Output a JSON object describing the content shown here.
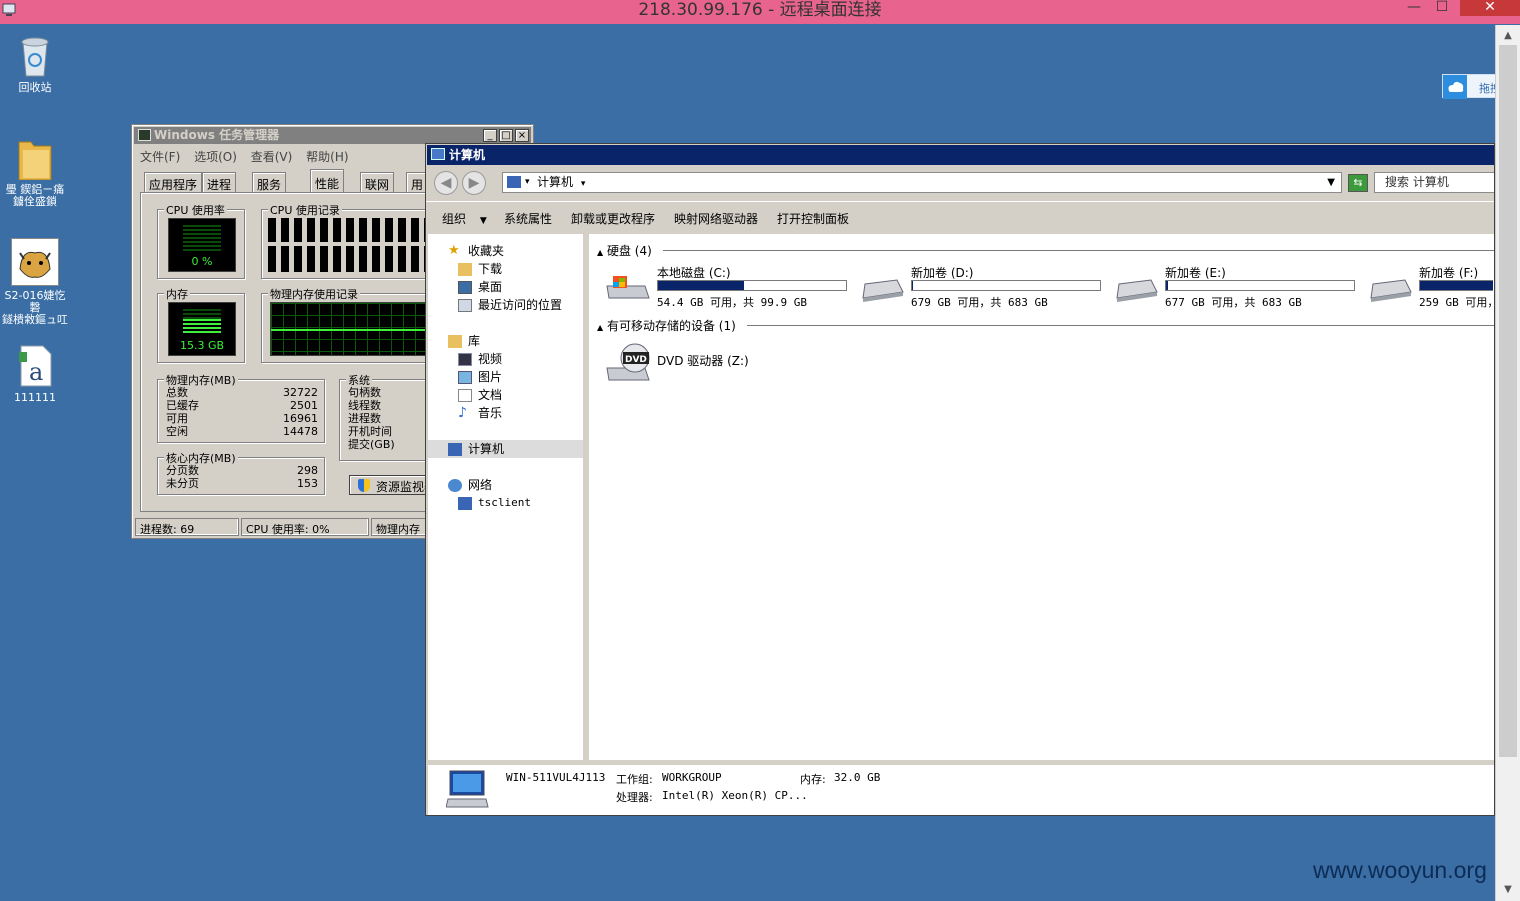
{
  "rdp": {
    "title": "218.30.99.176 - 远程桌面连接",
    "min_glyph": "—",
    "max_glyph": "☐",
    "close_glyph": "✕"
  },
  "desktop": {
    "icons": [
      {
        "label": "回收站",
        "icon": "recycle-bin-icon"
      },
      {
        "label": "璺 鍥鋁ㄧ痛\n鐪佺盛鎖",
        "icon": "folder-icon"
      },
      {
        "label": "S2-016婕忔礊\n鐩樻敹鏂ュ叿",
        "icon": "tomcat-icon"
      },
      {
        "label": "111111",
        "icon": "text-document-icon"
      }
    ]
  },
  "upload_widget": {
    "label": "拖拽上传"
  },
  "taskmgr": {
    "title": "Windows 任务管理器",
    "menu": [
      "文件(F)",
      "选项(O)",
      "查看(V)",
      "帮助(H)"
    ],
    "tabs": [
      "应用程序",
      "进程",
      "服务",
      "性能",
      "联网",
      "用"
    ],
    "active_tab": "性能",
    "cpu_usage_label": "CPU 使用率",
    "cpu_usage_value": "0 %",
    "cpu_history_label": "CPU 使用记录",
    "mem_label": "内存",
    "mem_value": "15.3 GB",
    "mem_history_label": "物理内存使用记录",
    "physical_memory": {
      "title": "物理内存(MB)",
      "rows": [
        {
          "k": "总数",
          "v": "32722"
        },
        {
          "k": "已缓存",
          "v": "2501"
        },
        {
          "k": "可用",
          "v": "16961"
        },
        {
          "k": "空闲",
          "v": "14478"
        }
      ]
    },
    "kernel_memory": {
      "title": "核心内存(MB)",
      "rows": [
        {
          "k": "分页数",
          "v": "298"
        },
        {
          "k": "未分页",
          "v": "153"
        }
      ]
    },
    "system": {
      "title": "系统",
      "rows": [
        "句柄数",
        "线程数",
        "进程数",
        "开机时间",
        "提交(GB)"
      ]
    },
    "resmon_button": "资源监视器",
    "status": [
      "进程数: 69",
      "CPU 使用率: 0%",
      "物理内存"
    ]
  },
  "explorer": {
    "title": "计算机",
    "address": "计算机",
    "search_placeholder": "搜索 计算机",
    "commands": [
      "组织",
      "系统属性",
      "卸载或更改程序",
      "映射网络驱动器",
      "打开控制面板"
    ],
    "nav": {
      "favorites": "收藏夹",
      "downloads": "下载",
      "desktop": "桌面",
      "recent": "最近访问的位置",
      "libraries": "库",
      "videos": "视频",
      "pictures": "图片",
      "documents": "文档",
      "music": "音乐",
      "computer": "计算机",
      "network": "网络",
      "tsclient": "tsclient"
    },
    "section_hdd": "硬盘 (4)",
    "section_removable": "有可移动存储的设备 (1)",
    "drives": [
      {
        "name": "本地磁盘 (C:)",
        "info": "54.4 GB 可用，共 99.9 GB",
        "used_fraction": 0.455
      },
      {
        "name": "新加卷 (D:)",
        "info": "679 GB 可用，共 683 GB",
        "used_fraction": 0.006
      },
      {
        "name": "新加卷 (E:)",
        "info": "677 GB 可用，共 683 GB",
        "used_fraction": 0.009
      },
      {
        "name": "新加卷 (F:)",
        "info": "259 GB 可用，",
        "used_fraction": 0.62
      }
    ],
    "dvd": {
      "name": "DVD 驱动器 (Z:)",
      "badge": "DVD"
    },
    "details": {
      "computer_name": "WIN-511VUL4J113",
      "workgroup_label": "工作组:",
      "workgroup": "WORKGROUP",
      "memory_label": "内存:",
      "memory": "32.0 GB",
      "cpu_label": "处理器:",
      "cpu": "Intel(R) Xeon(R) CP..."
    }
  },
  "watermark": "www.wooyun.org"
}
